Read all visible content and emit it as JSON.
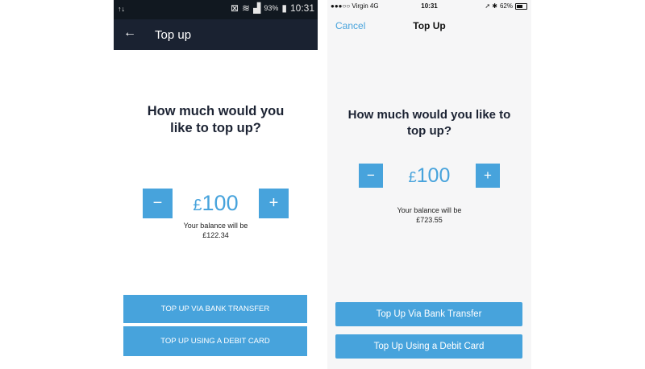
{
  "android": {
    "status": {
      "left_icon": "↑↓",
      "signal_text": "93%",
      "time": "10:31"
    },
    "header": {
      "back_icon": "←",
      "title": "Top up"
    },
    "question": "How much would you like to top up?",
    "stepper": {
      "minus": "−",
      "plus": "+",
      "currency": "£",
      "amount": "100"
    },
    "balance": {
      "line1": "Your balance will be",
      "line2": "£122.34"
    },
    "buttons": {
      "bank": "TOP UP VIA BANK TRANSFER",
      "card": "TOP UP USING A DEBIT CARD"
    }
  },
  "ios": {
    "status": {
      "carrier": "●●●○○ Virgin  4G",
      "time": "10:31",
      "battery": "62%",
      "right_icons": "➚ ✱"
    },
    "nav": {
      "cancel": "Cancel",
      "title": "Top Up"
    },
    "question": "How much would you like to top up?",
    "stepper": {
      "minus": "−",
      "plus": "+",
      "currency": "£",
      "amount": "100"
    },
    "balance": {
      "line1": "Your balance will be",
      "line2": "£723.55"
    },
    "buttons": {
      "bank": "Top Up Via Bank Transfer",
      "card": "Top Up Using a Debit Card"
    }
  },
  "colors": {
    "accent": "#47a3dc",
    "android_header": "#1a2231",
    "ios_bg": "#f6f6f7",
    "text_dark": "#1c2333"
  }
}
